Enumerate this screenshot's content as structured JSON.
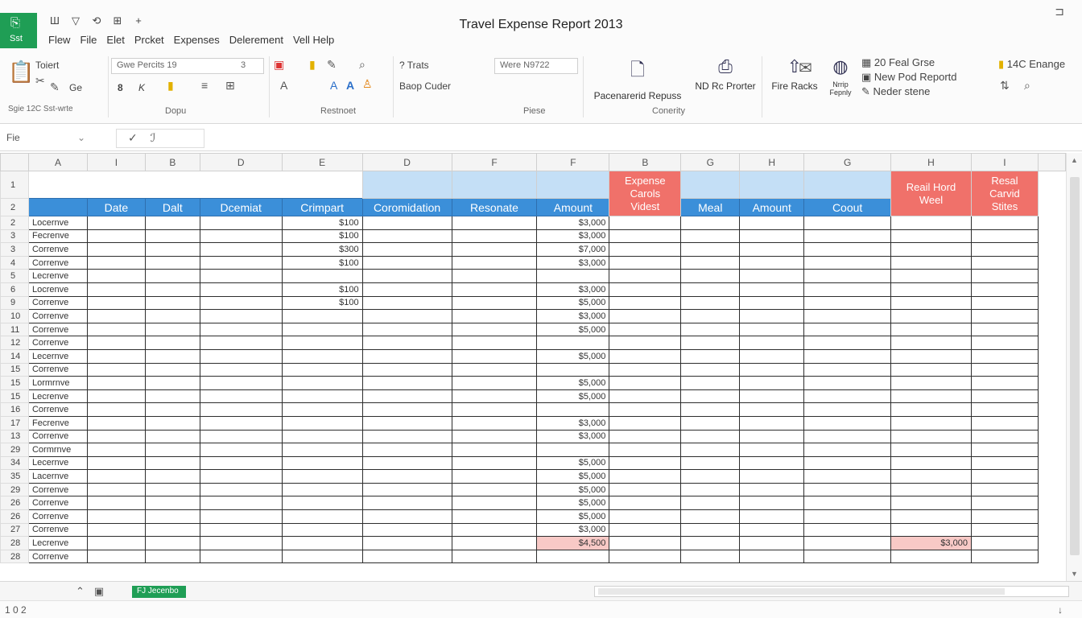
{
  "app": {
    "logo_glyph": "⎘",
    "logo_label": "Sst",
    "document_title": "Travel Expense Report 2013",
    "window_control": "⊐"
  },
  "quick_access": [
    "Ш",
    "▽",
    "⟲",
    "⊞",
    "+"
  ],
  "menu": [
    "Flew",
    "File",
    "Elet",
    "Prcket",
    "Expenses",
    "Delerement",
    "Vell Help"
  ],
  "ribbon": {
    "clipboard": {
      "label_1": "Toiert",
      "label_2": "Ge",
      "footer": "Sgie 12C Sst-wrte"
    },
    "font": {
      "font_select": "Gwe Percits 19",
      "size_select": "3",
      "bold": "8",
      "italic": "K",
      "group_label": "Dopu"
    },
    "alignment": {
      "wrap_label": "Restnoet"
    },
    "number": {
      "text_label": "? Trats",
      "merge_label": "Baop Cuder",
      "format_select": "Were N9722",
      "group_label": "Piese"
    },
    "insert": {
      "btn_1": "Pacenarerid Repuss",
      "btn_2": "ND Rc Prorter",
      "btn_3": "Fire Racks",
      "btn_4": "Nrrip Fepnly",
      "group_label": "Conerity"
    },
    "right_list": [
      "20 Feal Grse",
      "New Pod Reportd",
      "Neder stene"
    ],
    "far_right": "14C Enange"
  },
  "formula_bar": {
    "name_box": "Fie",
    "cancel": "✓",
    "fx": "ℐ"
  },
  "columns": [
    "A",
    "I",
    "B",
    "D",
    "E",
    "D",
    "F",
    "F",
    "B",
    "G",
    "H",
    "G",
    "H",
    "I"
  ],
  "header_row1": {
    "red_b": "Expense Carols Videst",
    "red_h": "Reail Hord Weel",
    "red_i": "Resal Carvid Stites"
  },
  "header_row2": [
    "Date",
    "Dalt",
    "Dcemiat",
    "Crimpart",
    "Coromidation",
    "Resonate",
    "Amount",
    "",
    "Meal",
    "Amount",
    "Coout",
    "",
    ""
  ],
  "rows": [
    {
      "num": "2",
      "a": "Locernve",
      "e": "$100",
      "h": "$3,000"
    },
    {
      "num": "3",
      "a": "Fecrenve",
      "e": "$100",
      "h": "$3,000"
    },
    {
      "num": "3",
      "a": "Correnve",
      "e": "$300",
      "h": "$7,000"
    },
    {
      "num": "4",
      "a": "Correnve",
      "e": "$100",
      "h": "$3,000"
    },
    {
      "num": "5",
      "a": "Lecrenve",
      "e": "",
      "h": ""
    },
    {
      "num": "6",
      "a": "Locrenve",
      "e": "$100",
      "h": "$3,000"
    },
    {
      "num": "9",
      "a": "Correnve",
      "e": "$100",
      "h": "$5,000"
    },
    {
      "num": "10",
      "a": "Correnve",
      "e": "",
      "h": "$3,000"
    },
    {
      "num": "11",
      "a": "Correnve",
      "e": "",
      "h": "$5,000"
    },
    {
      "num": "12",
      "a": "Correnve",
      "e": "",
      "h": ""
    },
    {
      "num": "14",
      "a": "Lecernve",
      "e": "",
      "h": "$5,000"
    },
    {
      "num": "15",
      "a": "Correnve",
      "e": "",
      "h": ""
    },
    {
      "num": "15",
      "a": "Lormrnve",
      "e": "",
      "h": "$5,000"
    },
    {
      "num": "15",
      "a": "Lecrenve",
      "e": "",
      "h": "$5,000"
    },
    {
      "num": "16",
      "a": "Correnve",
      "e": "",
      "h": ""
    },
    {
      "num": "17",
      "a": "Fecrenve",
      "e": "",
      "h": "$3,000"
    },
    {
      "num": "13",
      "a": "Correnve",
      "e": "",
      "h": "$3,000"
    },
    {
      "num": "29",
      "a": "Cormrnve",
      "e": "",
      "h": ""
    },
    {
      "num": "34",
      "a": "Lecernve",
      "e": "",
      "h": "$5,000"
    },
    {
      "num": "35",
      "a": "Lacernve",
      "e": "",
      "h": "$5,000"
    },
    {
      "num": "29",
      "a": "Correnve",
      "e": "",
      "h": "$5,000"
    },
    {
      "num": "26",
      "a": "Correnve",
      "e": "",
      "h": "$5,000"
    },
    {
      "num": "26",
      "a": "Correnve",
      "e": "",
      "h": "$5,000"
    },
    {
      "num": "27",
      "a": "Correnve",
      "e": "",
      "h": "$3,000"
    },
    {
      "num": "28",
      "a": "Lecrenve",
      "e": "",
      "h": "$4,500",
      "h_pink": true,
      "l": "$3,000",
      "l_pink": true
    },
    {
      "num": "28",
      "a": "Correnve",
      "e": "",
      "h": ""
    }
  ],
  "sheet_tab": "FJ Jecenbo",
  "status": {
    "left": "1 0 2",
    "right": "↓"
  },
  "colors": {
    "accent": "#1f9e55",
    "header_blue": "#3b8fd9",
    "light_blue": "#c4dff6",
    "header_red": "#f0716a",
    "pink": "#f8c9c6"
  }
}
